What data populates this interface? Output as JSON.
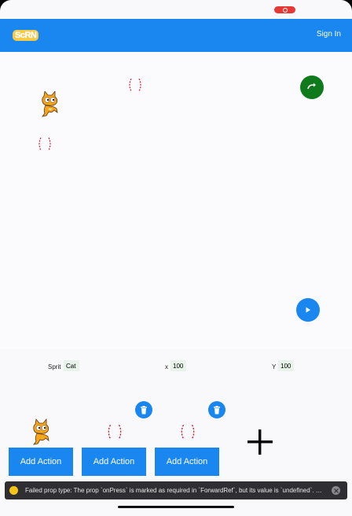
{
  "header": {
    "logo_text": "ScRN",
    "signin_label": "Sign In"
  },
  "stage": {
    "sprites": [
      {
        "name": "cat-sprite",
        "icon": "scratch-cat"
      },
      {
        "name": "ball-sprite",
        "icon": "baseball"
      },
      {
        "name": "ball-sprite",
        "icon": "baseball"
      }
    ],
    "reset_icon": "refresh-icon",
    "play_icon": "play-icon"
  },
  "properties": {
    "sprite_label": "Sprit",
    "sprite_value": "Cat",
    "x_label": "x",
    "x_value": "100",
    "y_label": "Y",
    "y_value": "100"
  },
  "actions": {
    "add_label": "Add Action",
    "plus_label": "+"
  },
  "toast": {
    "message": "Failed prop type: The prop `onPress` is marked as required in `ForwardRef`, but its value is `undefined`. Wa..."
  },
  "colors": {
    "primary": "#1a86f0",
    "reset_green": "#0e7a1b",
    "toast_bg": "#2f2f33"
  }
}
